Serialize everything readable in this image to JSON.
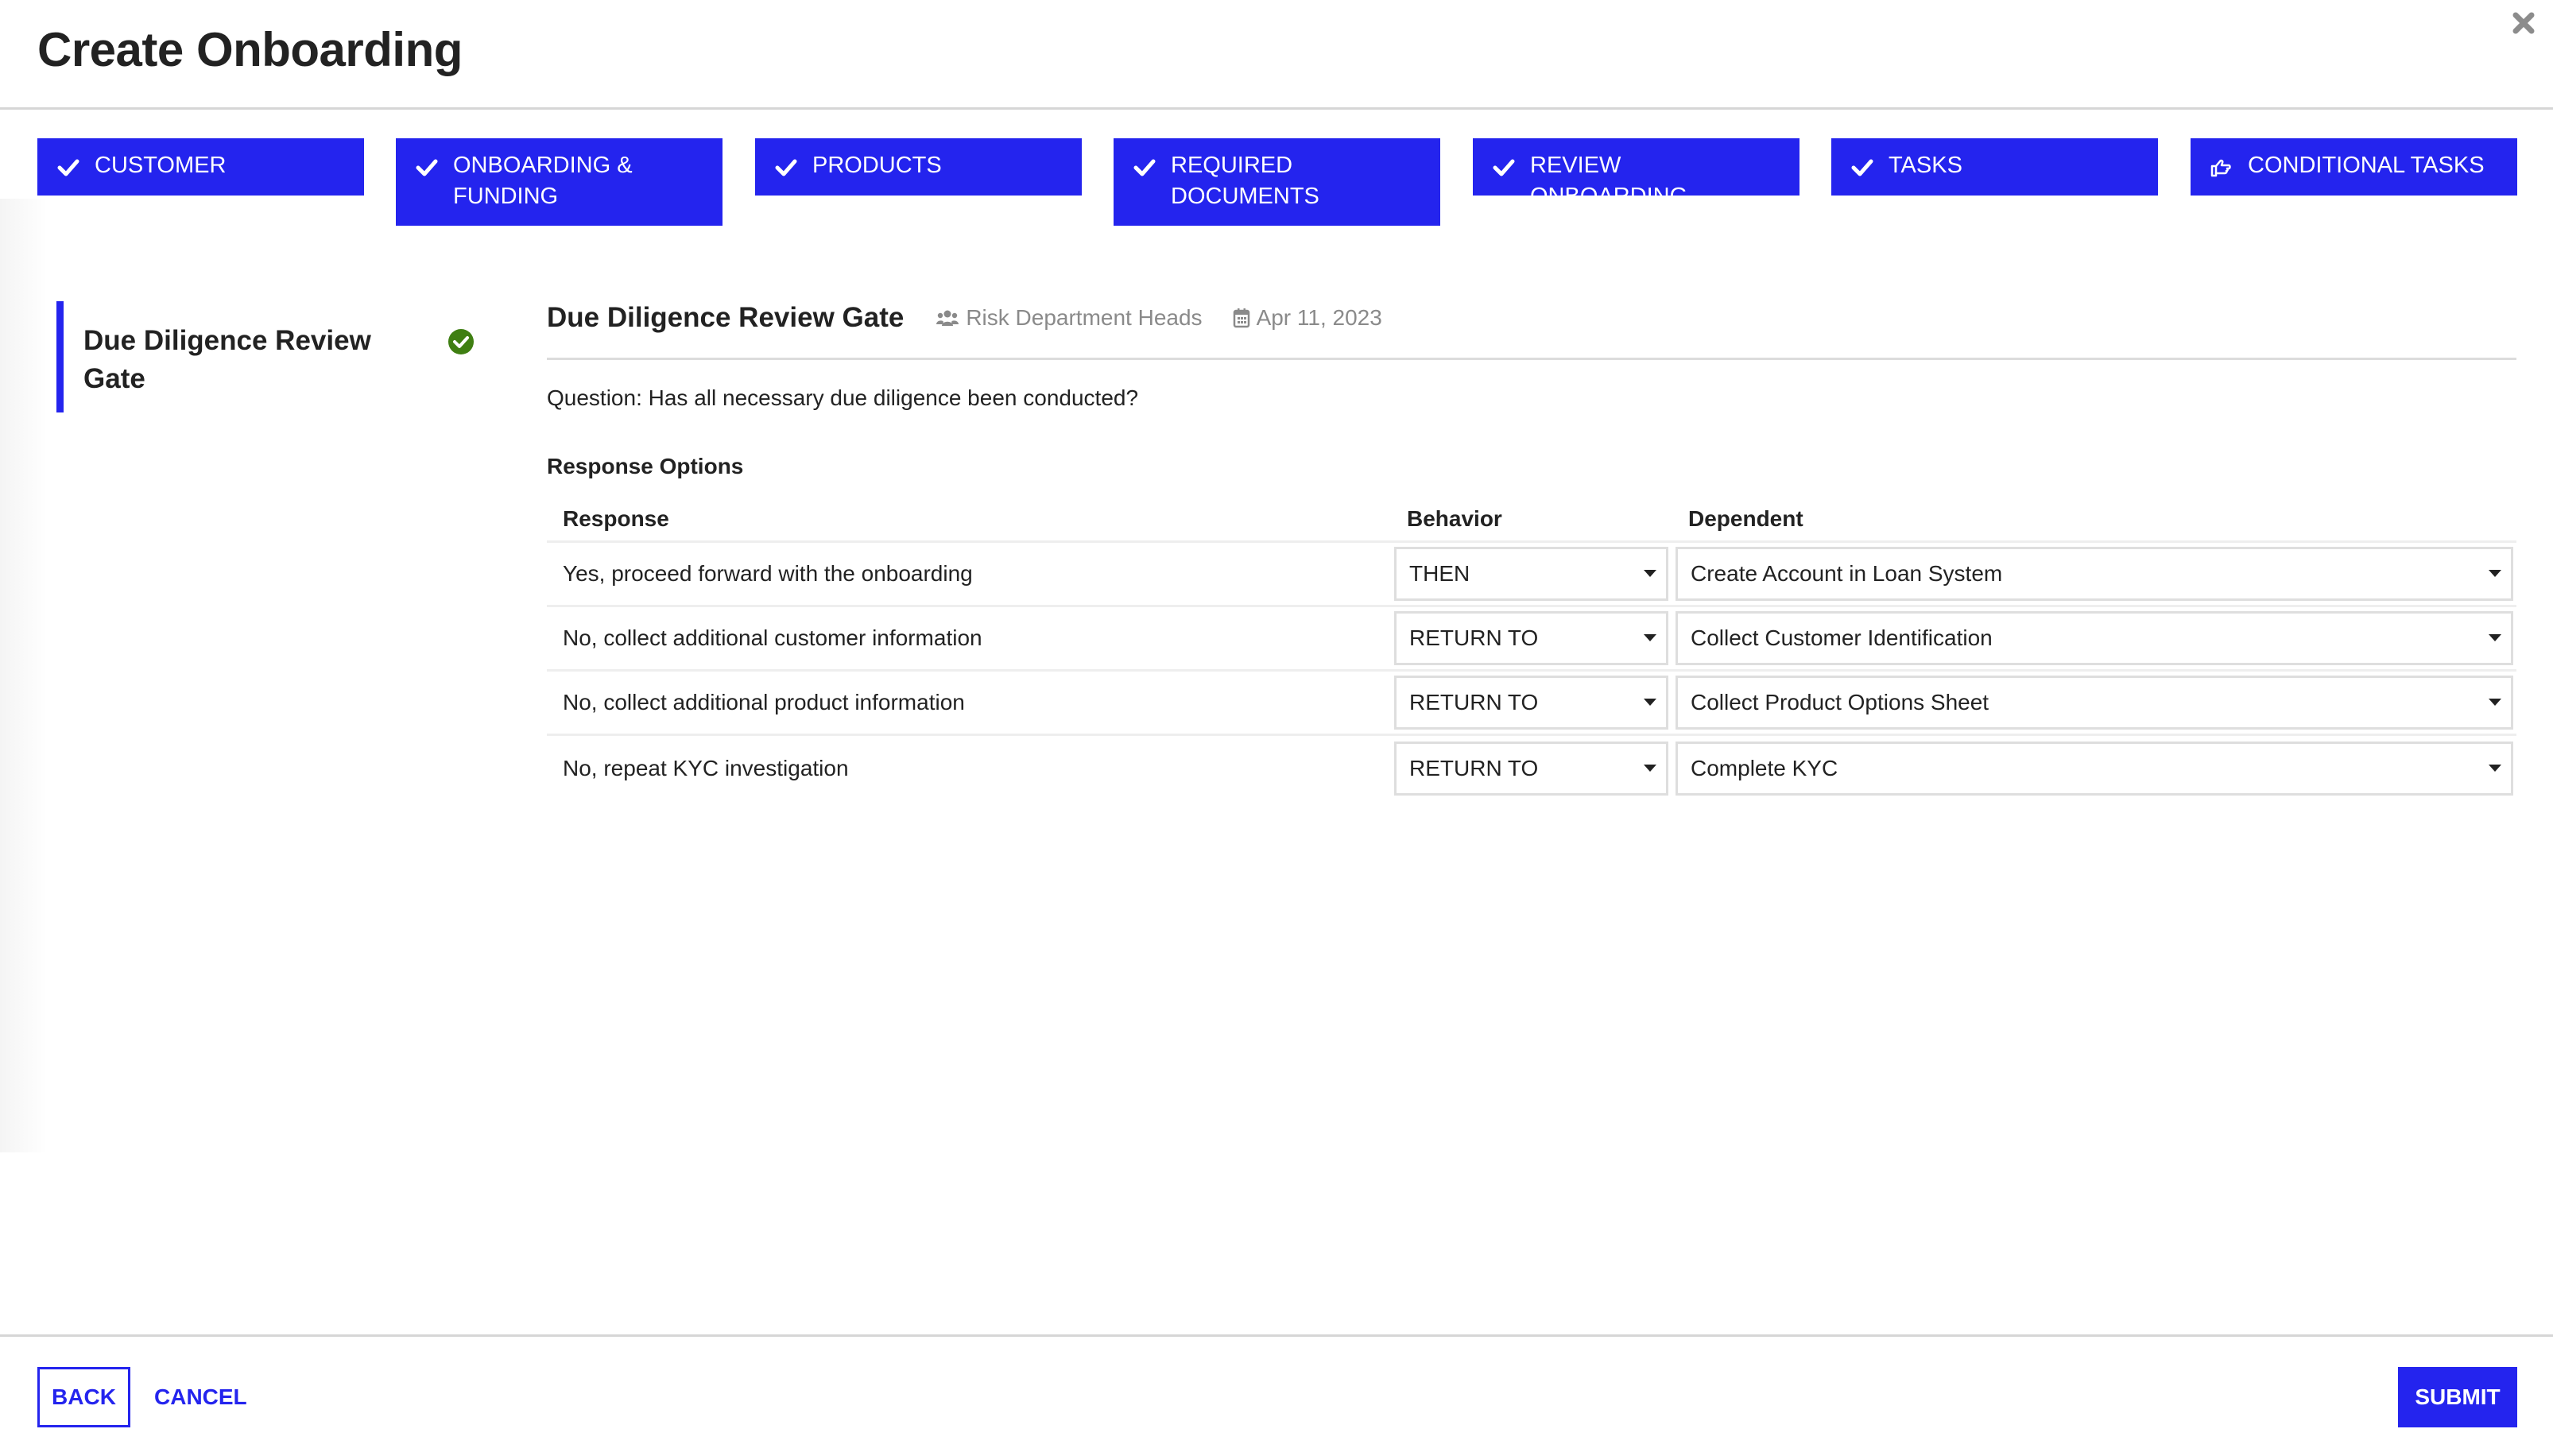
{
  "header": {
    "title": "Create Onboarding",
    "close_icon": "close-icon"
  },
  "tabs": [
    {
      "label": "Customer",
      "icon": "check-icon",
      "completed": true
    },
    {
      "label": "Onboarding & Funding",
      "icon": "check-icon",
      "completed": true
    },
    {
      "label": "Products",
      "icon": "check-icon",
      "completed": true
    },
    {
      "label": "Required Documents",
      "icon": "check-icon",
      "completed": true
    },
    {
      "label": "Review Onboarding",
      "icon": "check-icon",
      "completed": true
    },
    {
      "label": "Tasks",
      "icon": "check-icon",
      "completed": true
    },
    {
      "label": "Conditional Tasks",
      "icon": "hand-pointer-right-icon",
      "completed": false,
      "active": true
    }
  ],
  "gates": [
    {
      "name": "Due Diligence Review Gate",
      "status": "complete",
      "status_icon": "check-circle-icon",
      "selected": true
    }
  ],
  "detail": {
    "title": "Due Diligence Review Gate",
    "assignee": "Risk Department Heads",
    "assignee_icon": "users-icon",
    "date": "Apr 11, 2023",
    "date_icon": "calendar-icon",
    "question": "Question: Has all necessary due diligence been conducted?",
    "section_label": "Response Options",
    "columns": {
      "response": "Response",
      "behavior": "Behavior",
      "dependent": "Dependent"
    },
    "rows": [
      {
        "response": "Yes, proceed forward with the onboarding",
        "behavior": "THEN",
        "dependent": "Create Account in Loan System"
      },
      {
        "response": "No, collect additional customer information",
        "behavior": "RETURN TO",
        "dependent": "Collect Customer Identification"
      },
      {
        "response": "No, collect additional product information",
        "behavior": "RETURN TO",
        "dependent": "Collect Product Options Sheet"
      },
      {
        "response": "No, repeat KYC investigation",
        "behavior": "RETURN TO",
        "dependent": "Complete KYC"
      }
    ]
  },
  "footer": {
    "back_label": "BACK",
    "cancel_label": "CANCEL",
    "submit_label": "SUBMIT"
  },
  "colors": {
    "brand": "#2424ee",
    "success": "#3f7f12",
    "muted": "#8a8a8a",
    "text": "#222222"
  }
}
